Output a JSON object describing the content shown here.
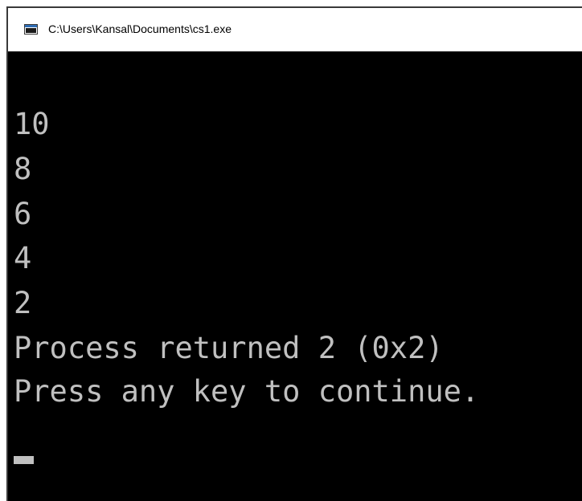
{
  "window": {
    "title": "C:\\Users\\Kansal\\Documents\\cs1.exe",
    "icon": "console-app-icon"
  },
  "console": {
    "lines": [
      "10",
      "8",
      "6",
      "4",
      "2",
      "Process returned 2 (0x2)",
      "Press any key to continue."
    ]
  },
  "colors": {
    "console_background": "#000000",
    "console_text": "#c0c0c0",
    "titlebar_background": "#ffffff"
  }
}
